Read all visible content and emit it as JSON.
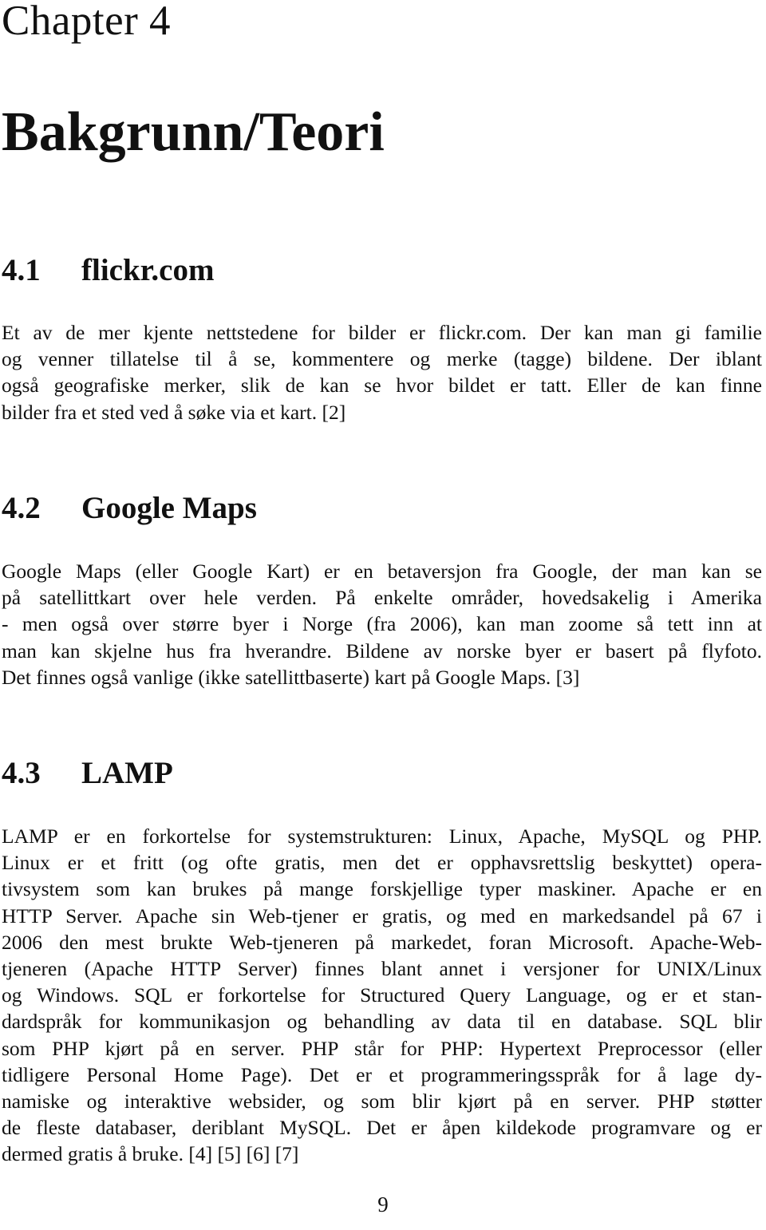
{
  "chapter": {
    "label": "Chapter 4",
    "title": "Bakgrunn/Teori"
  },
  "sections": [
    {
      "number": "4.1",
      "title": "flickr.com",
      "lines": [
        "Et av de mer kjente nettstedene for bilder er flickr.com. Der kan man gi familie",
        "og venner tillatelse til å se, kommentere og merke (tagge) bildene. Der iblant",
        "også geografiske merker, slik de kan se hvor bildet er tatt. Eller de kan finne",
        "bilder fra et sted ved å søke via et kart. [2]"
      ]
    },
    {
      "number": "4.2",
      "title": "Google Maps",
      "lines": [
        "Google Maps (eller Google Kart) er en betaversjon fra Google, der man kan se",
        "på satellittkart over hele verden. På enkelte områder, hovedsakelig i Amerika",
        "- men også over større byer i Norge (fra 2006), kan man zoome så tett inn at",
        "man kan skjelne hus fra hverandre. Bildene av norske byer er basert på flyfoto.",
        "Det finnes også vanlige (ikke satellittbaserte) kart på Google Maps. [3]"
      ]
    },
    {
      "number": "4.3",
      "title": "LAMP",
      "lines": [
        "LAMP er en forkortelse for systemstrukturen: Linux, Apache, MySQL og PHP.",
        "Linux er et fritt (og ofte gratis, men det er opphavsrettslig beskyttet) opera-",
        "tivsystem som kan brukes på mange forskjellige typer maskiner. Apache er en",
        "HTTP Server. Apache sin Web-tjener er gratis, og med en markedsandel på 67 i",
        "2006 den mest brukte Web-tjeneren på markedet, foran Microsoft. Apache-Web-",
        "tjeneren (Apache HTTP Server) finnes blant annet i versjoner for UNIX/Linux",
        "og Windows. SQL er forkortelse for Structured Query Language, og er et stan-",
        "dardspråk for kommunikasjon og behandling av data til en database. SQL blir",
        "som PHP kjørt på en server. PHP står for PHP: Hypertext Preprocessor (eller",
        "tidligere Personal Home Page). Det er et programmeringsspråk for å lage dy-",
        "namiske og interaktive websider, og som blir kjørt på en server. PHP støtter",
        "de fleste databaser, deriblant MySQL. Det er åpen kildekode programvare og er",
        "dermed gratis å bruke. [4] [5] [6] [7]"
      ]
    }
  ],
  "page_number": "9"
}
